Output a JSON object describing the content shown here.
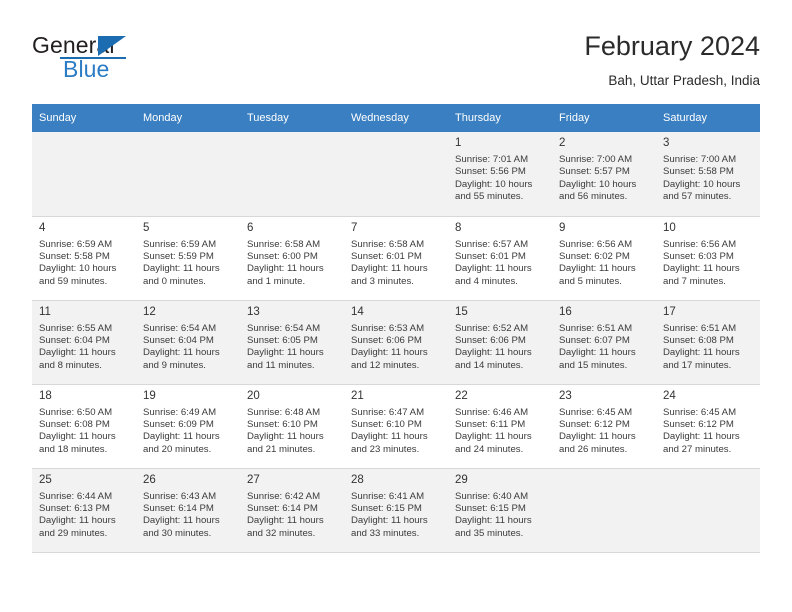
{
  "brand": {
    "name_part1": "General",
    "name_part2": "Blue",
    "accent_color": "#1b6cb0"
  },
  "header": {
    "title": "February 2024",
    "subtitle": "Bah, Uttar Pradesh, India"
  },
  "calendar": {
    "header_bg": "#3a7fc1",
    "weekdays": [
      "Sunday",
      "Monday",
      "Tuesday",
      "Wednesday",
      "Thursday",
      "Friday",
      "Saturday"
    ],
    "weeks": [
      [
        {
          "day": "",
          "lines": []
        },
        {
          "day": "",
          "lines": []
        },
        {
          "day": "",
          "lines": []
        },
        {
          "day": "",
          "lines": []
        },
        {
          "day": "1",
          "lines": [
            "Sunrise: 7:01 AM",
            "Sunset: 5:56 PM",
            "Daylight: 10 hours",
            "and 55 minutes."
          ]
        },
        {
          "day": "2",
          "lines": [
            "Sunrise: 7:00 AM",
            "Sunset: 5:57 PM",
            "Daylight: 10 hours",
            "and 56 minutes."
          ]
        },
        {
          "day": "3",
          "lines": [
            "Sunrise: 7:00 AM",
            "Sunset: 5:58 PM",
            "Daylight: 10 hours",
            "and 57 minutes."
          ]
        }
      ],
      [
        {
          "day": "4",
          "lines": [
            "Sunrise: 6:59 AM",
            "Sunset: 5:58 PM",
            "Daylight: 10 hours",
            "and 59 minutes."
          ]
        },
        {
          "day": "5",
          "lines": [
            "Sunrise: 6:59 AM",
            "Sunset: 5:59 PM",
            "Daylight: 11 hours",
            "and 0 minutes."
          ]
        },
        {
          "day": "6",
          "lines": [
            "Sunrise: 6:58 AM",
            "Sunset: 6:00 PM",
            "Daylight: 11 hours",
            "and 1 minute."
          ]
        },
        {
          "day": "7",
          "lines": [
            "Sunrise: 6:58 AM",
            "Sunset: 6:01 PM",
            "Daylight: 11 hours",
            "and 3 minutes."
          ]
        },
        {
          "day": "8",
          "lines": [
            "Sunrise: 6:57 AM",
            "Sunset: 6:01 PM",
            "Daylight: 11 hours",
            "and 4 minutes."
          ]
        },
        {
          "day": "9",
          "lines": [
            "Sunrise: 6:56 AM",
            "Sunset: 6:02 PM",
            "Daylight: 11 hours",
            "and 5 minutes."
          ]
        },
        {
          "day": "10",
          "lines": [
            "Sunrise: 6:56 AM",
            "Sunset: 6:03 PM",
            "Daylight: 11 hours",
            "and 7 minutes."
          ]
        }
      ],
      [
        {
          "day": "11",
          "lines": [
            "Sunrise: 6:55 AM",
            "Sunset: 6:04 PM",
            "Daylight: 11 hours",
            "and 8 minutes."
          ]
        },
        {
          "day": "12",
          "lines": [
            "Sunrise: 6:54 AM",
            "Sunset: 6:04 PM",
            "Daylight: 11 hours",
            "and 9 minutes."
          ]
        },
        {
          "day": "13",
          "lines": [
            "Sunrise: 6:54 AM",
            "Sunset: 6:05 PM",
            "Daylight: 11 hours",
            "and 11 minutes."
          ]
        },
        {
          "day": "14",
          "lines": [
            "Sunrise: 6:53 AM",
            "Sunset: 6:06 PM",
            "Daylight: 11 hours",
            "and 12 minutes."
          ]
        },
        {
          "day": "15",
          "lines": [
            "Sunrise: 6:52 AM",
            "Sunset: 6:06 PM",
            "Daylight: 11 hours",
            "and 14 minutes."
          ]
        },
        {
          "day": "16",
          "lines": [
            "Sunrise: 6:51 AM",
            "Sunset: 6:07 PM",
            "Daylight: 11 hours",
            "and 15 minutes."
          ]
        },
        {
          "day": "17",
          "lines": [
            "Sunrise: 6:51 AM",
            "Sunset: 6:08 PM",
            "Daylight: 11 hours",
            "and 17 minutes."
          ]
        }
      ],
      [
        {
          "day": "18",
          "lines": [
            "Sunrise: 6:50 AM",
            "Sunset: 6:08 PM",
            "Daylight: 11 hours",
            "and 18 minutes."
          ]
        },
        {
          "day": "19",
          "lines": [
            "Sunrise: 6:49 AM",
            "Sunset: 6:09 PM",
            "Daylight: 11 hours",
            "and 20 minutes."
          ]
        },
        {
          "day": "20",
          "lines": [
            "Sunrise: 6:48 AM",
            "Sunset: 6:10 PM",
            "Daylight: 11 hours",
            "and 21 minutes."
          ]
        },
        {
          "day": "21",
          "lines": [
            "Sunrise: 6:47 AM",
            "Sunset: 6:10 PM",
            "Daylight: 11 hours",
            "and 23 minutes."
          ]
        },
        {
          "day": "22",
          "lines": [
            "Sunrise: 6:46 AM",
            "Sunset: 6:11 PM",
            "Daylight: 11 hours",
            "and 24 minutes."
          ]
        },
        {
          "day": "23",
          "lines": [
            "Sunrise: 6:45 AM",
            "Sunset: 6:12 PM",
            "Daylight: 11 hours",
            "and 26 minutes."
          ]
        },
        {
          "day": "24",
          "lines": [
            "Sunrise: 6:45 AM",
            "Sunset: 6:12 PM",
            "Daylight: 11 hours",
            "and 27 minutes."
          ]
        }
      ],
      [
        {
          "day": "25",
          "lines": [
            "Sunrise: 6:44 AM",
            "Sunset: 6:13 PM",
            "Daylight: 11 hours",
            "and 29 minutes."
          ]
        },
        {
          "day": "26",
          "lines": [
            "Sunrise: 6:43 AM",
            "Sunset: 6:14 PM",
            "Daylight: 11 hours",
            "and 30 minutes."
          ]
        },
        {
          "day": "27",
          "lines": [
            "Sunrise: 6:42 AM",
            "Sunset: 6:14 PM",
            "Daylight: 11 hours",
            "and 32 minutes."
          ]
        },
        {
          "day": "28",
          "lines": [
            "Sunrise: 6:41 AM",
            "Sunset: 6:15 PM",
            "Daylight: 11 hours",
            "and 33 minutes."
          ]
        },
        {
          "day": "29",
          "lines": [
            "Sunrise: 6:40 AM",
            "Sunset: 6:15 PM",
            "Daylight: 11 hours",
            "and 35 minutes."
          ]
        },
        {
          "day": "",
          "lines": []
        },
        {
          "day": "",
          "lines": []
        }
      ]
    ]
  }
}
